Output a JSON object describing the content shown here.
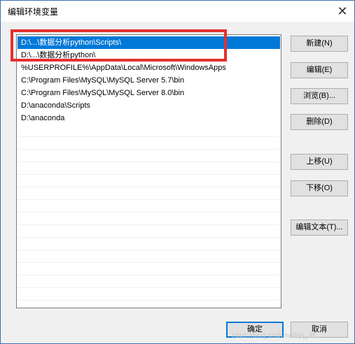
{
  "window": {
    "title": "编辑环境变量",
    "close_glyph": "✕"
  },
  "list": {
    "items": [
      "D:\\...\\数据分析python\\Scripts\\",
      "D:\\...\\数据分析python\\",
      "%USERPROFILE%\\AppData\\Local\\Microsoft\\WindowsApps",
      "C:\\Program Files\\MySQL\\MySQL Server 5.7\\bin",
      "C:\\Program Files\\MySQL\\MySQL Server 8.0\\bin",
      "D:\\anaconda\\Scripts",
      "D:\\anaconda"
    ],
    "selected_index": 0
  },
  "buttons": {
    "new": "新建(N)",
    "edit": "编辑(E)",
    "browse": "浏览(B)...",
    "delete": "删除(D)",
    "move_up": "上移(U)",
    "move_down": "下移(O)",
    "edit_text": "编辑文本(T)...",
    "ok": "确定",
    "cancel": "取消"
  },
  "watermark": "https://blog.csdn.net/qq_35...",
  "colors": {
    "selection": "#0078d7",
    "highlight_box": "#e5302f"
  }
}
